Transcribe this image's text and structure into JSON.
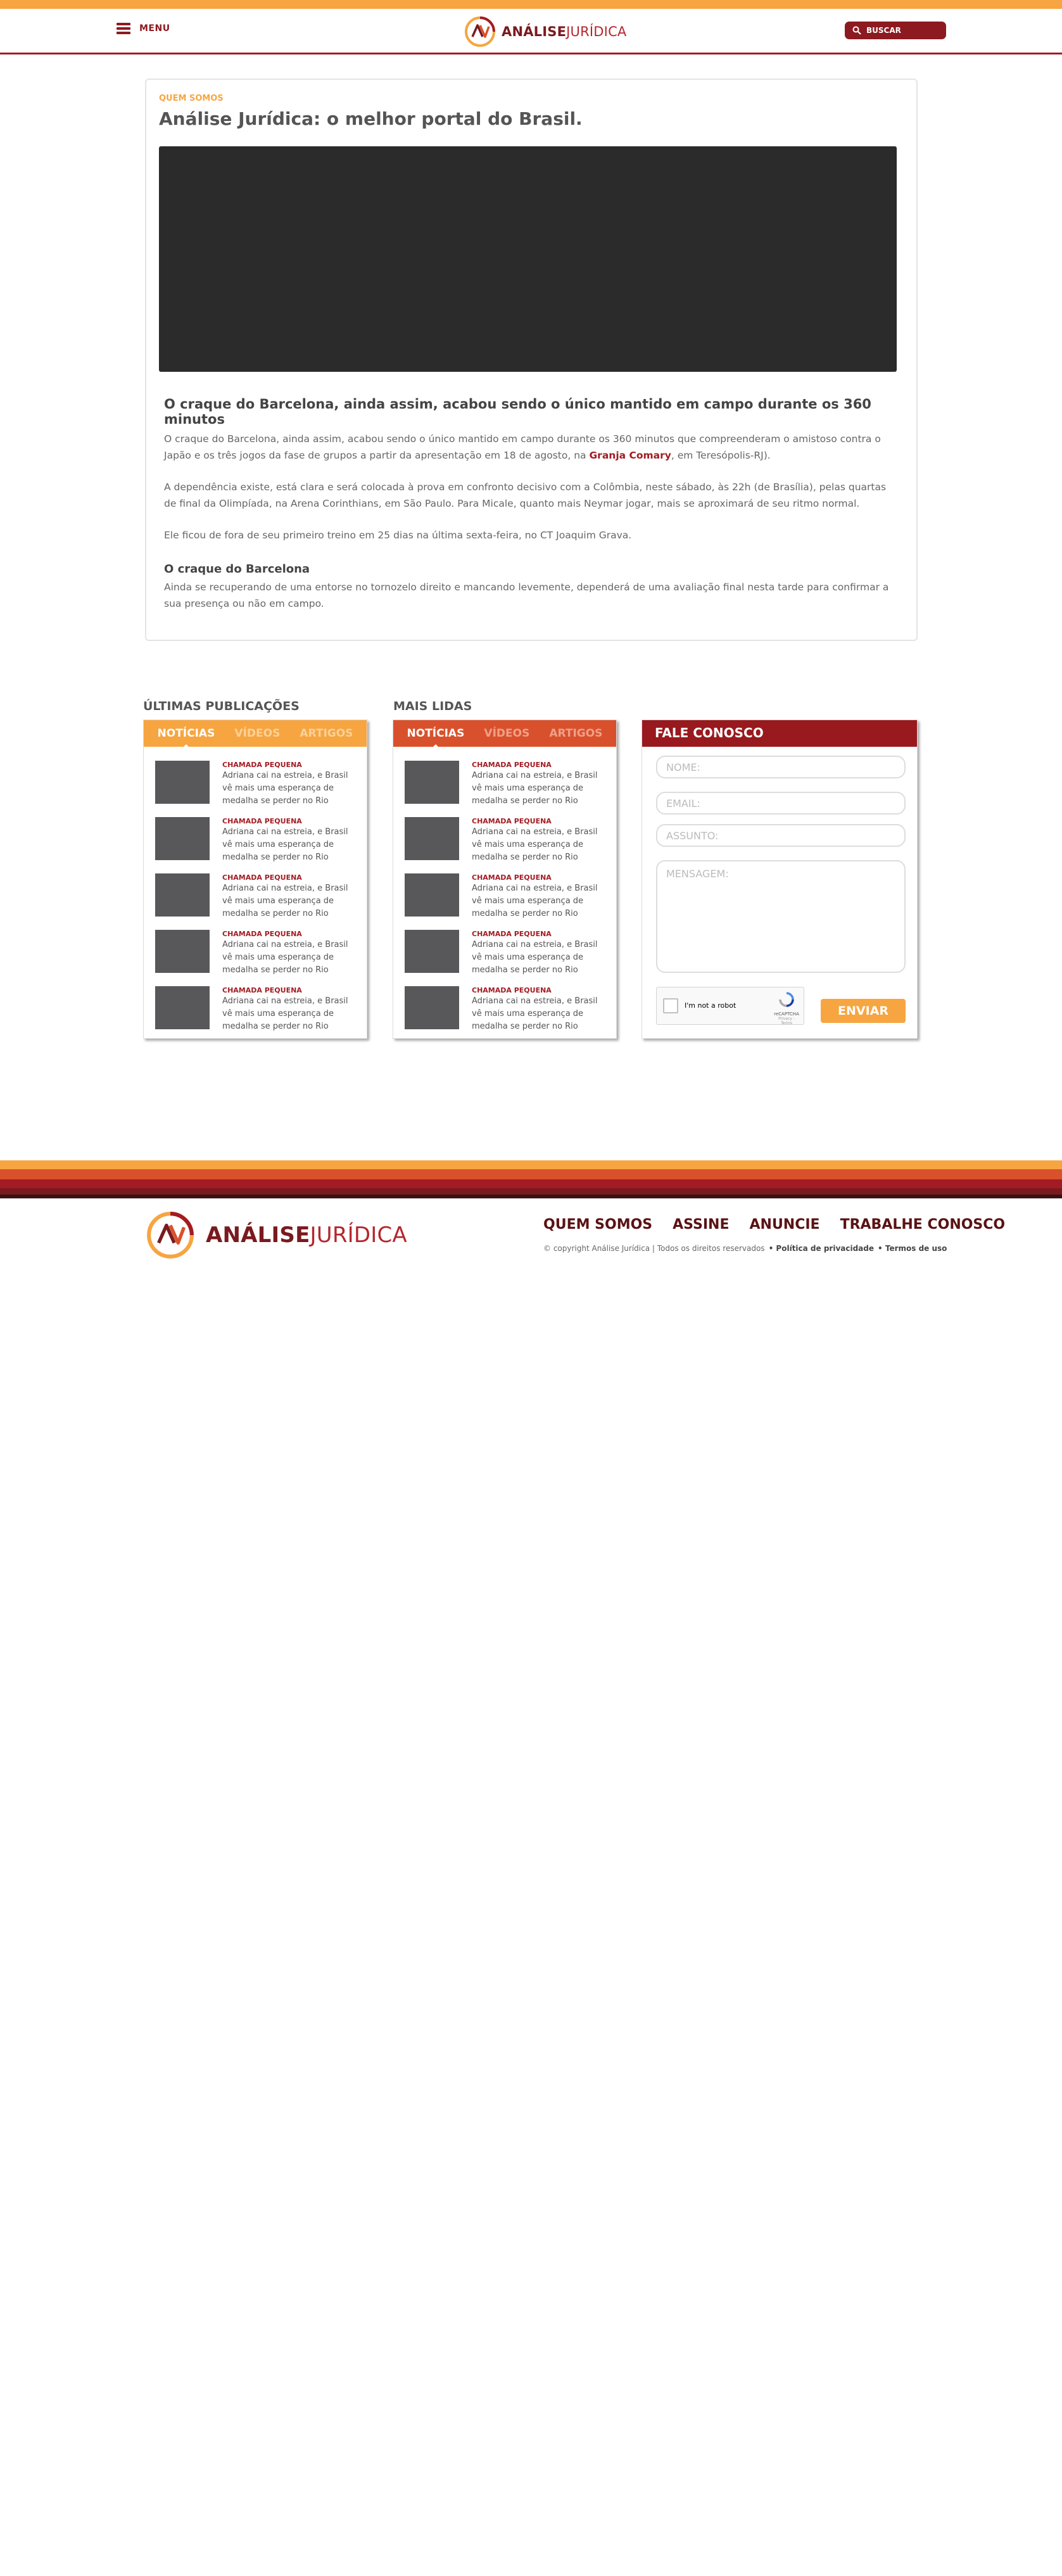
{
  "header": {
    "menu_label": "MENU",
    "logo_bold": "ANÁLISE",
    "logo_light": "JURÍDICA",
    "search_label": "BUSCAR"
  },
  "about": {
    "eyebrow": "QUEM SOMOS",
    "title": "Análise Jurídica: o melhor portal do Brasil.",
    "article_heading": "O craque do Barcelona, ainda assim, acabou sendo o único mantido em campo durante os 360 minutos",
    "p1_before": "O craque do Barcelona, ainda assim, acabou sendo o único mantido em campo durante os 360 minutos que compreenderam o amistoso contra o Japão e os três jogos da fase de grupos a partir da apresentação em 18 de agosto, na ",
    "p1_link": "Granja Comary",
    "p1_after": ", em Teresópolis-RJ).",
    "p2": "A dependência existe, está clara e será colocada à prova em confronto decisivo com a Colômbia, neste sábado, às 22h (de Brasília), pelas quartas de final da Olimpíada, na Arena Corinthians, em São Paulo. Para Micale, quanto mais Neymar jogar, mais se aproximará de seu ritmo normal.",
    "p3": "Ele ficou de fora de seu primeiro treino em 25 dias na última sexta-feira, no CT Joaquim Grava.",
    "sub_heading": "O craque do Barcelona",
    "p4": "Ainda se recuperando de uma entorse no tornozelo direito e mancando levemente, dependerá de uma avaliação final nesta tarde para confirmar a sua presença ou não em campo."
  },
  "latest": {
    "section_title": "ÚLTIMAS PUBLICAÇÕES",
    "tabs": [
      "NOTÍCIAS",
      "VÍDEOS",
      "ARTIGOS"
    ],
    "items": [
      {
        "tag": "CHAMADA PEQUENA",
        "text": "Adriana cai na estreia, e Brasil vê mais uma esperança de medalha se perder no Rio"
      },
      {
        "tag": "CHAMADA PEQUENA",
        "text": "Adriana cai na estreia, e Brasil vê mais uma esperança de medalha se perder no Rio"
      },
      {
        "tag": "CHAMADA PEQUENA",
        "text": "Adriana cai na estreia, e Brasil vê mais uma esperança de medalha se perder no Rio"
      },
      {
        "tag": "CHAMADA PEQUENA",
        "text": "Adriana cai na estreia, e Brasil vê mais uma esperança de medalha se perder no Rio"
      },
      {
        "tag": "CHAMADA PEQUENA",
        "text": "Adriana cai na estreia, e Brasil vê mais uma esperança de medalha se perder no Rio"
      }
    ]
  },
  "most_read": {
    "section_title": "MAIS LIDAS",
    "tabs": [
      "NOTÍCIAS",
      "VÍDEOS",
      "ARTIGOS"
    ],
    "items": [
      {
        "tag": "CHAMADA PEQUENA",
        "text": "Adriana cai na estreia, e Brasil vê mais uma esperança de medalha se perder no Rio"
      },
      {
        "tag": "CHAMADA PEQUENA",
        "text": "Adriana cai na estreia, e Brasil vê mais uma esperança de medalha se perder no Rio"
      },
      {
        "tag": "CHAMADA PEQUENA",
        "text": "Adriana cai na estreia, e Brasil vê mais uma esperança de medalha se perder no Rio"
      },
      {
        "tag": "CHAMADA PEQUENA",
        "text": "Adriana cai na estreia, e Brasil vê mais uma esperança de medalha se perder no Rio"
      },
      {
        "tag": "CHAMADA PEQUENA",
        "text": "Adriana cai na estreia, e Brasil vê mais uma esperança de medalha se perder no Rio"
      }
    ]
  },
  "contact": {
    "title": "FALE CONOSCO",
    "name_placeholder": "NOME:",
    "email_placeholder": "EMAIL:",
    "subject_placeholder": "ASSUNTO:",
    "message_placeholder": "MENSAGEM:",
    "captcha_label": "I'm not a robot",
    "captcha_brand": "reCAPTCHA",
    "captcha_terms": "Privacy - Terms",
    "submit_label": "ENVIAR"
  },
  "footer": {
    "logo_bold": "ANÁLISE",
    "logo_light": "JURÍDICA",
    "links": [
      "QUEM SOMOS",
      "ASSINE",
      "ANUNCIE",
      "TRABALHE CONOSCO"
    ],
    "copyright": "© copyright Análise Jurídica  |  Todos os direitos reservados",
    "privacy": "• Política de privacidade",
    "terms": "• Termos de uso"
  },
  "colors": {
    "orange": "#f7a540",
    "red_orange": "#d9512c",
    "crimson": "#a31c23",
    "dark_red": "#7a1a1e"
  }
}
